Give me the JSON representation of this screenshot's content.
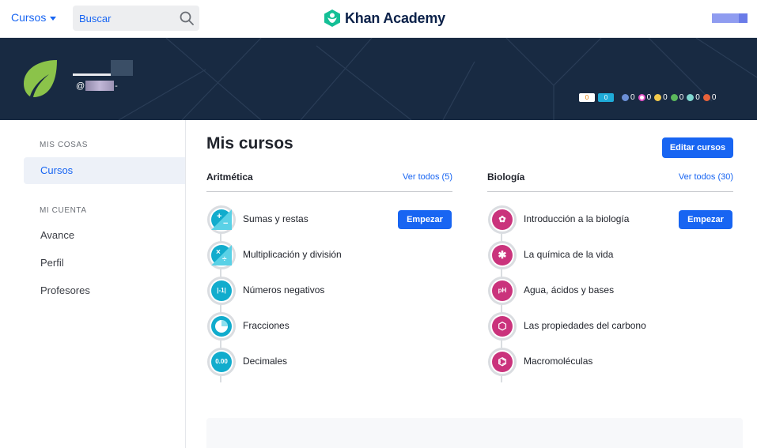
{
  "header": {
    "courses_label": "Cursos",
    "search_placeholder": "Buscar",
    "logo_text": "Khan Academy"
  },
  "profile": {
    "username_prefix": "@",
    "username_suffix": "-",
    "streak": "0",
    "points": "0",
    "badges": [
      {
        "icon": "meteorite-badge-icon",
        "count": "0",
        "color": "#6b8fd6"
      },
      {
        "icon": "moon-badge-icon",
        "count": "0",
        "color": "#e255c7"
      },
      {
        "icon": "earth-badge-icon",
        "count": "0",
        "color": "#f2c94c"
      },
      {
        "icon": "sun-badge-icon",
        "count": "0",
        "color": "#5bb85c"
      },
      {
        "icon": "black-hole-badge-icon",
        "count": "0",
        "color": "#7fd6cf"
      },
      {
        "icon": "challenge-patch-icon",
        "count": "0",
        "color": "#e8623a"
      }
    ]
  },
  "sidebar": {
    "section1": "MIS COSAS",
    "item_courses": "Cursos",
    "section2": "MI CUENTA",
    "item_progress": "Avance",
    "item_profile": "Perfil",
    "item_teachers": "Profesores"
  },
  "main": {
    "title": "Mis cursos",
    "edit_button": "Editar cursos",
    "start_label": "Empezar",
    "courses": [
      {
        "title": "Aritmética",
        "link": "Ver todos (5)",
        "theme": "blue",
        "units": [
          {
            "label": "Sumas y restas",
            "icon": "plus-minus-icon",
            "glyph": "+−"
          },
          {
            "label": "Multiplicación y división",
            "icon": "times-divide-icon",
            "glyph": "×÷"
          },
          {
            "label": "Números negativos",
            "icon": "absolute-value-icon",
            "glyph": "|-1|"
          },
          {
            "label": "Fracciones",
            "icon": "pie-fraction-icon",
            "glyph": ""
          },
          {
            "label": "Decimales",
            "icon": "decimal-icon",
            "glyph": "0.00"
          }
        ]
      },
      {
        "title": "Biología",
        "link": "Ver todos (30)",
        "theme": "pink",
        "units": [
          {
            "label": "Introducción a la biología",
            "icon": "flower-icon",
            "glyph": "✿"
          },
          {
            "label": "La química de la vida",
            "icon": "molecule-icon",
            "glyph": "✱"
          },
          {
            "label": "Agua, ácidos y bases",
            "icon": "ph-icon",
            "glyph": "pH"
          },
          {
            "label": "Las propiedades del carbono",
            "icon": "carbon-ring-icon",
            "glyph": "⬡"
          },
          {
            "label": "Macromoléculas",
            "icon": "macromolecule-icon",
            "glyph": "⌬"
          }
        ]
      }
    ]
  }
}
